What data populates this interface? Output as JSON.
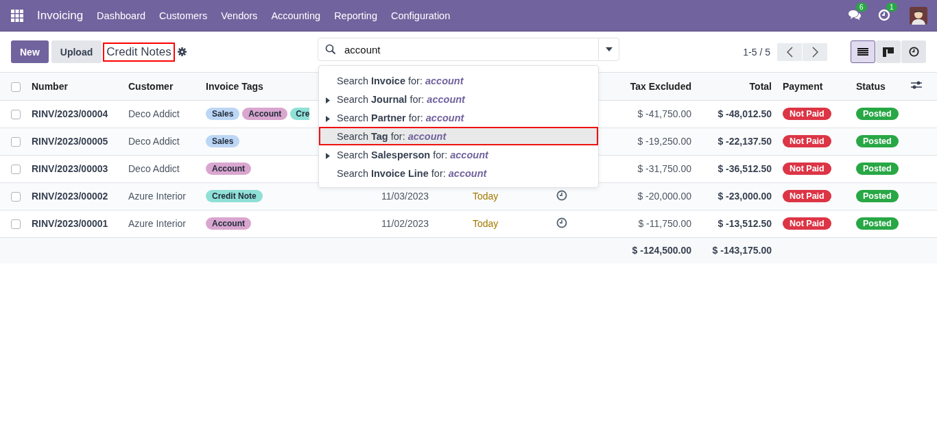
{
  "navbar": {
    "app_name": "Invoicing",
    "menu": [
      "Dashboard",
      "Customers",
      "Vendors",
      "Accounting",
      "Reporting",
      "Configuration"
    ],
    "systray": [
      {
        "kind": "messages",
        "badge": "6"
      },
      {
        "kind": "activities",
        "badge": "1"
      }
    ]
  },
  "control_panel": {
    "buttons": [
      {
        "label": "New",
        "kind": "primary"
      },
      {
        "label": "Upload",
        "kind": "secondary"
      }
    ],
    "breadcrumb": {
      "label": "Credit Notes",
      "highlighted": true
    },
    "search": {
      "value": "account"
    },
    "pager": "1-5 / 5",
    "views": [
      {
        "kind": "list",
        "selected": true
      },
      {
        "kind": "kanban",
        "selected": false
      },
      {
        "kind": "activity",
        "selected": false
      }
    ]
  },
  "table": {
    "all_checked": false,
    "columns": [
      "Number",
      "Customer",
      "Invoice Tags",
      "Tax Excluded",
      "Total",
      "Payment",
      "Status"
    ],
    "rows": [
      {
        "checked": false,
        "number": "RINV/2023/00004",
        "customer": "Deco Addict",
        "tags": [
          {
            "label": "Sales",
            "color": "#bcd6f5"
          },
          {
            "label": "Account",
            "color": "#d9a6cf"
          },
          {
            "label": "Cre",
            "color": "#8fe0d6",
            "cut": true
          }
        ],
        "tax_excluded": "$ -41,750.00",
        "total": "$ -48,012.50",
        "payment": "Not Paid",
        "status": "Posted"
      },
      {
        "checked": false,
        "number": "RINV/2023/00005",
        "customer": "Deco Addict",
        "tags": [
          {
            "label": "Sales",
            "color": "#bcd6f5"
          }
        ],
        "tax_excluded": "$ -19,250.00",
        "total": "$ -22,137.50",
        "payment": "Not Paid",
        "status": "Posted"
      },
      {
        "checked": false,
        "number": "RINV/2023/00003",
        "customer": "Deco Addict",
        "tags": [
          {
            "label": "Account",
            "color": "#d9a6cf"
          }
        ],
        "tax_excluded": "$ -31,750.00",
        "total": "$ -36,512.50",
        "payment": "Not Paid",
        "status": "Posted"
      },
      {
        "checked": false,
        "number": "RINV/2023/00002",
        "customer": "Azure Interior",
        "tags": [
          {
            "label": "Credit Note",
            "color": "#8fe0d6"
          }
        ],
        "date": "11/03/2023",
        "due": "Today",
        "activity": true,
        "tax_excluded": "$ -20,000.00",
        "total": "$ -23,000.00",
        "payment": "Not Paid",
        "status": "Posted"
      },
      {
        "checked": false,
        "number": "RINV/2023/00001",
        "customer": "Azure Interior",
        "tags": [
          {
            "label": "Account",
            "color": "#d9a6cf"
          }
        ],
        "date": "11/02/2023",
        "due": "Today",
        "activity": true,
        "tax_excluded": "$ -11,750.00",
        "total": "$ -13,512.50",
        "payment": "Not Paid",
        "status": "Posted"
      }
    ],
    "totals": {
      "tax_excluded": "$ -124,500.00",
      "total": "$ -143,175.00"
    }
  },
  "search_dropdown": [
    {
      "label": "Search **Invoice** for:",
      "query": "account",
      "expandable": false,
      "selected": false,
      "highlighted": false
    },
    {
      "label": "Search **Journal** for:",
      "query": "account",
      "expandable": true,
      "selected": false,
      "highlighted": false
    },
    {
      "label": "Search **Partner** for:",
      "query": "account",
      "expandable": true,
      "selected": false,
      "highlighted": false
    },
    {
      "label": "Search **Tag** for:",
      "query": "account",
      "expandable": false,
      "selected": true,
      "highlighted": true
    },
    {
      "label": "Search **Salesperson** for:",
      "query": "account",
      "expandable": true,
      "selected": false,
      "highlighted": false
    },
    {
      "label": "Search **Invoice Line** for:",
      "query": "account",
      "expandable": false,
      "selected": false,
      "highlighted": false
    }
  ]
}
